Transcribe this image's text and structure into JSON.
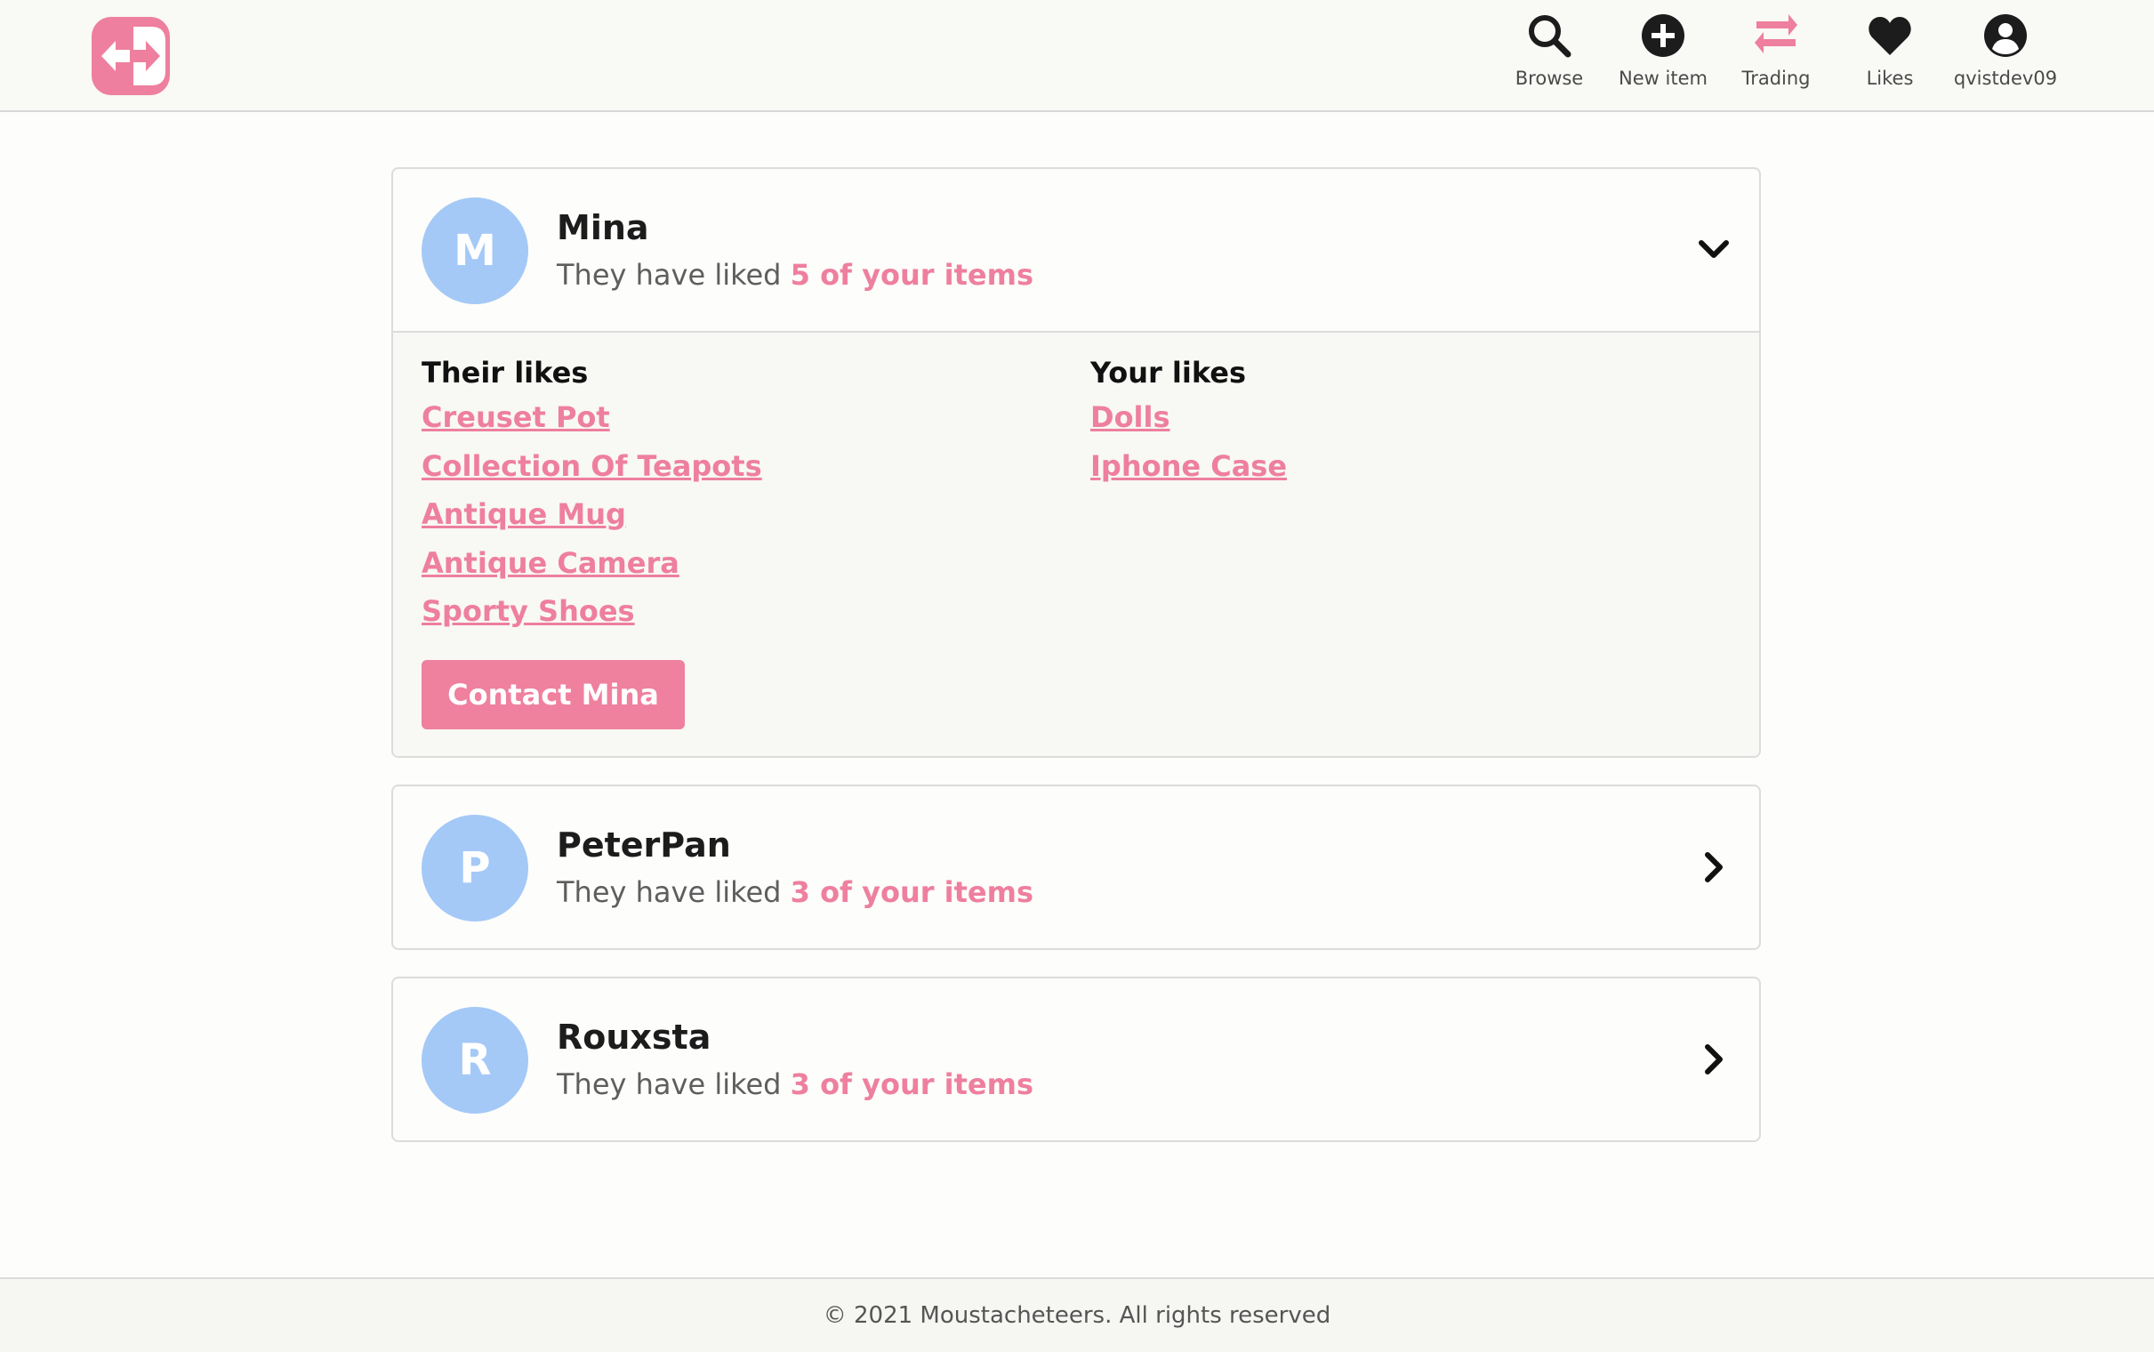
{
  "app": {
    "logo_icon": "swap-logo-icon",
    "accent": "#ee7f9e",
    "avatar_color": "#a4c9f7"
  },
  "nav": [
    {
      "label": "Browse",
      "icon": "search-icon"
    },
    {
      "label": "New item",
      "icon": "plus-circle-icon"
    },
    {
      "label": "Trading",
      "icon": "swap-arrows-icon"
    },
    {
      "label": "Likes",
      "icon": "heart-icon"
    },
    {
      "label": "qvistdev09",
      "icon": "user-circle-icon"
    }
  ],
  "matches": [
    {
      "initial": "M",
      "name": "Mina",
      "sub_prefix": "They have liked",
      "count_text": "5 of your items",
      "expanded": true,
      "their_likes_title": "Their likes",
      "their_likes": [
        "Creuset Pot",
        "Collection Of Teapots",
        "Antique Mug",
        "Antique Camera",
        "Sporty Shoes"
      ],
      "your_likes_title": "Your likes",
      "your_likes": [
        "Dolls",
        "Iphone Case"
      ],
      "contact_label": "Contact Mina"
    },
    {
      "initial": "P",
      "name": "PeterPan",
      "sub_prefix": "They have liked",
      "count_text": "3 of your items",
      "expanded": false
    },
    {
      "initial": "R",
      "name": "Rouxsta",
      "sub_prefix": "They have liked",
      "count_text": "3 of your items",
      "expanded": false
    }
  ],
  "footer": {
    "text": "© 2021 Moustacheteers. All rights reserved"
  }
}
